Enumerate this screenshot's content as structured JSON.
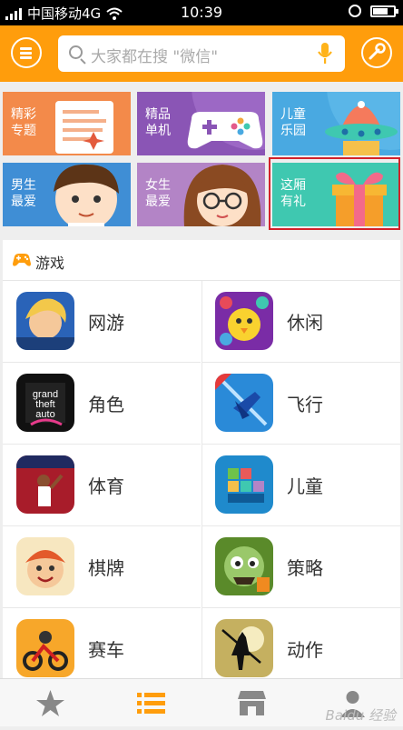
{
  "status_bar": {
    "carrier": "中国移动4G",
    "time": "10:39"
  },
  "header": {
    "search_placeholder": "大家都在搜 \"微信\""
  },
  "tiles": [
    {
      "label": "精彩专题",
      "color": "#f38a4a"
    },
    {
      "label": "精品单机",
      "color": "#8a55b5"
    },
    {
      "label": "儿童乐园",
      "color": "#49a9e1"
    },
    {
      "label": "男生最爱",
      "color": "#3f8ed5"
    },
    {
      "label": "女生最爱",
      "color": "#b384c6"
    },
    {
      "label": "这厢有礼",
      "color": "#3fc8b0"
    }
  ],
  "games": {
    "title": "游戏",
    "categories": [
      "网游",
      "休闲",
      "角色",
      "飞行",
      "体育",
      "儿童",
      "棋牌",
      "策略",
      "赛车",
      "动作"
    ]
  },
  "nav": {
    "icons": [
      "star-icon",
      "list-icon",
      "store-icon",
      "person-icon"
    ],
    "active_color": "#ff9d0c"
  },
  "watermark": "Baidu 经验"
}
